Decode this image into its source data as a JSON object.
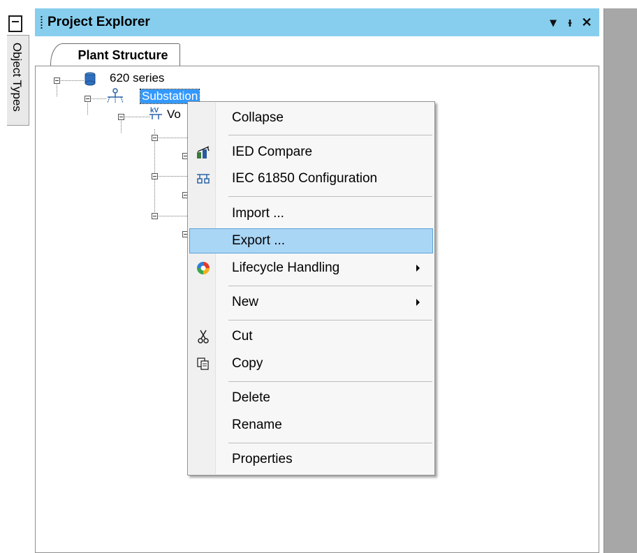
{
  "side_tab": {
    "label": "Object Types"
  },
  "panel": {
    "title": "Project Explorer",
    "buttons": {
      "dropdown": "▾",
      "pin": "ᵻ",
      "close": "✕"
    },
    "tab": "Plant Structure"
  },
  "tree": {
    "root": "620 series",
    "substation": "Substation",
    "voltage_level": "Vo"
  },
  "context_menu": {
    "items": [
      {
        "label": "Collapse"
      },
      {
        "label": "IED Compare"
      },
      {
        "label": "IEC 61850 Configuration"
      },
      {
        "label": "Import ..."
      },
      {
        "label": "Export ..."
      },
      {
        "label": "Lifecycle Handling"
      },
      {
        "label": "New"
      },
      {
        "label": "Cut"
      },
      {
        "label": "Copy"
      },
      {
        "label": "Delete"
      },
      {
        "label": "Rename"
      },
      {
        "label": "Properties"
      }
    ],
    "highlighted": "Export ..."
  },
  "colors": {
    "titlebar": "#87ceee",
    "highlight": "#aad6f5",
    "selection": "#3399ff",
    "right_area": "#a7a7a7"
  }
}
